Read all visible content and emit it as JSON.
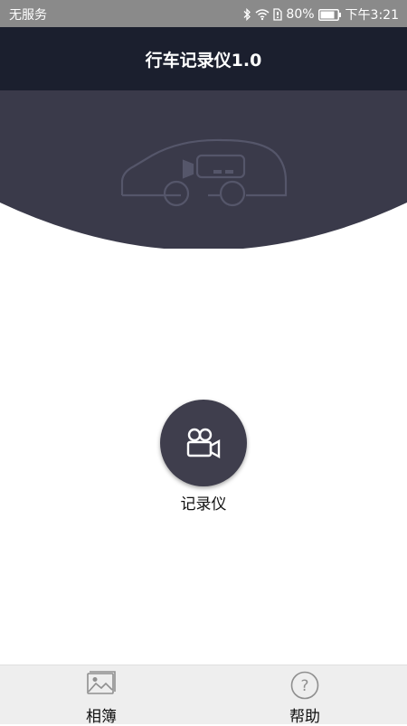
{
  "status_bar": {
    "carrier": "无服务",
    "battery": "80%",
    "time": "下午3:21"
  },
  "header": {
    "title": "行车记录仪1.0"
  },
  "main": {
    "record_label": "记录仪"
  },
  "bottom_nav": {
    "items": [
      {
        "label": "相簿",
        "icon": "image-icon"
      },
      {
        "label": "帮助",
        "icon": "help-icon"
      }
    ]
  },
  "colors": {
    "header_bg": "#1b1f2e",
    "hero_bg": "#3a3a4a",
    "button_bg": "#3f3e4d",
    "status_bg": "#8a8a8a",
    "nav_bg": "#eeeeee"
  }
}
